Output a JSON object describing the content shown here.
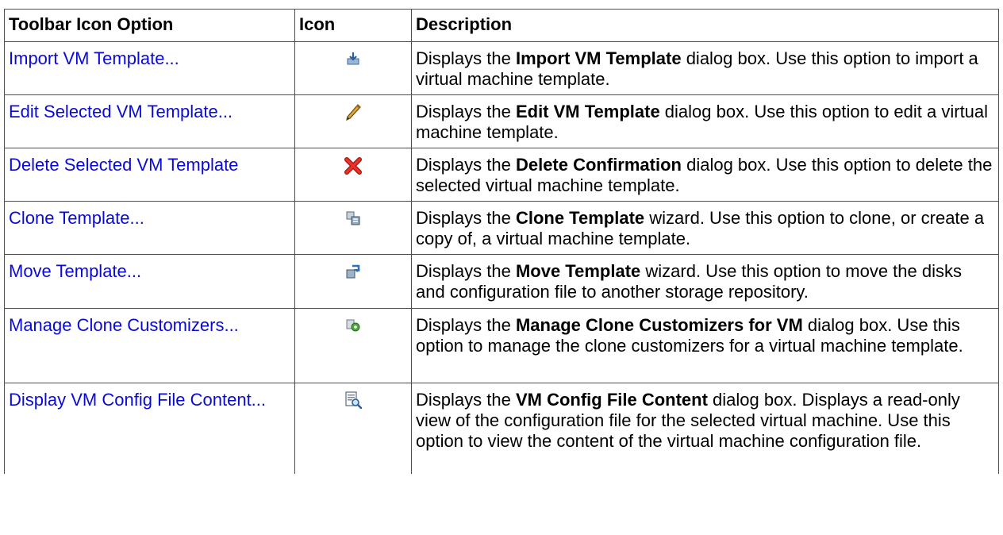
{
  "headers": {
    "option": "Toolbar Icon Option",
    "icon": "Icon",
    "description": "Description"
  },
  "rows": [
    {
      "option": "Import VM Template...",
      "icon": "import-icon",
      "desc_pre": "Displays the ",
      "desc_bold": "Import VM Template",
      "desc_post": " dialog box. Use this option to import a virtual machine template."
    },
    {
      "option": "Edit Selected VM Template...",
      "icon": "pencil-icon",
      "desc_pre": "Displays the ",
      "desc_bold": "Edit VM Template",
      "desc_post": " dialog box. Use this option to edit a virtual machine template."
    },
    {
      "option": "Delete Selected VM Template",
      "icon": "delete-x-icon",
      "desc_pre": "Displays the ",
      "desc_bold": "Delete Confirmation",
      "desc_post": " dialog box. Use this option to delete the selected virtual machine template."
    },
    {
      "option": "Clone Template...",
      "icon": "clone-icon",
      "desc_pre": "Displays the ",
      "desc_bold": "Clone Template",
      "desc_post": " wizard. Use this option to clone, or create a copy of, a virtual machine template."
    },
    {
      "option": "Move Template...",
      "icon": "move-icon",
      "desc_pre": "Displays the ",
      "desc_bold": "Move Template",
      "desc_post": " wizard. Use this option to move the disks and configuration file to another storage repository."
    },
    {
      "option": "Manage Clone Customizers...",
      "icon": "gear-icon",
      "desc_pre": "Displays the ",
      "desc_bold": "Manage Clone Customizers for VM",
      "desc_post": " dialog box. Use this option to manage the clone customizers for a virtual machine template."
    },
    {
      "option": "Display VM Config File Content...",
      "icon": "view-file-icon",
      "desc_pre": "Displays the ",
      "desc_bold": "VM Config File Content",
      "desc_post": " dialog box. Displays a read-only view of the configuration file for the selected virtual machine. Use this option to view the content of the virtual machine configuration file."
    }
  ]
}
